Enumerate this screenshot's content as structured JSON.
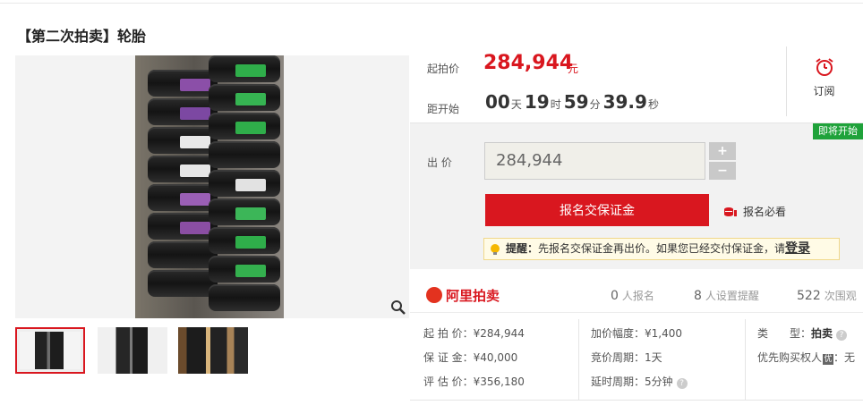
{
  "title": "【第二次拍卖】轮胎",
  "price": {
    "start_label": "起拍价",
    "start_value": "284,944",
    "currency": "元",
    "countdown_label": "距开始",
    "days": "00",
    "days_unit": "天",
    "hours": "19",
    "hours_unit": "时",
    "minutes": "59",
    "minutes_unit": "分",
    "seconds": "39.9",
    "seconds_unit": "秒"
  },
  "subscribe": {
    "label": "订阅",
    "icon": "alarm-clock-icon"
  },
  "bid": {
    "badge": "即将开始",
    "label": "出 价",
    "value": "284,944",
    "plus": "+",
    "minus": "−",
    "signup_button": "报名交保证金",
    "must_read": "报名必看",
    "reminder_prefix": "提醒：",
    "reminder_text": "先报名交保证金再出价。如果您已经交付保证金，请",
    "reminder_link": "登录"
  },
  "stats": {
    "logo": "阿里拍卖",
    "signups_count": "0",
    "signups_label": "人报名",
    "reminders_count": "8",
    "reminders_label": "人设置提醒",
    "views_count": "522",
    "views_label": "次围观"
  },
  "details": {
    "start_price_label": "起 拍 价：",
    "start_price_value": "¥284,944",
    "deposit_label": "保 证 金：",
    "deposit_value": "¥40,000",
    "appraisal_label": "评 估 价：",
    "appraisal_value": "¥356,180",
    "increment_label": "加价幅度：",
    "increment_value": "¥1,400",
    "cycle_label": "竞价周期：",
    "cycle_value": "1天",
    "delay_label": "延时周期：",
    "delay_value": "5分钟",
    "type_label": "类　　型：",
    "type_value": "拍卖",
    "priority_label": "优先购买权人",
    "priority_badge": "优",
    "priority_value": "：无"
  },
  "colors": {
    "accent": "#d9171f",
    "badge": "#1fa23a"
  }
}
